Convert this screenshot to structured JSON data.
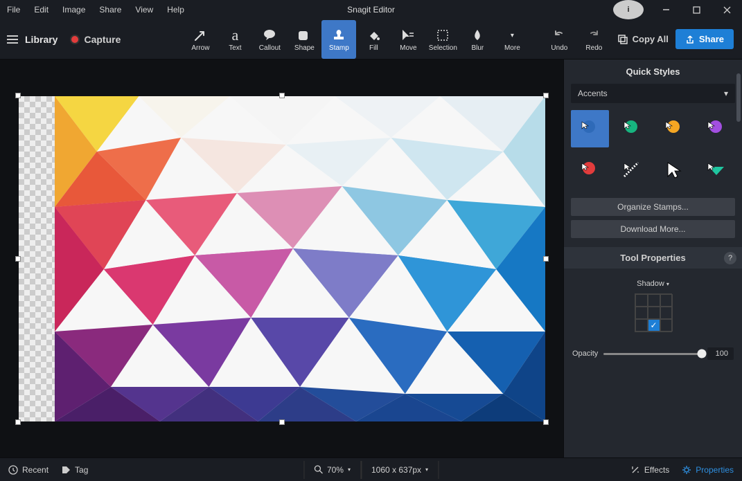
{
  "app_title": "Snagit Editor",
  "menu": [
    "File",
    "Edit",
    "Image",
    "Share",
    "View",
    "Help"
  ],
  "header": {
    "library": "Library",
    "capture": "Capture",
    "copy_all": "Copy All",
    "share": "Share"
  },
  "tools": [
    {
      "id": "arrow",
      "label": "Arrow"
    },
    {
      "id": "text",
      "label": "Text"
    },
    {
      "id": "callout",
      "label": "Callout"
    },
    {
      "id": "shape",
      "label": "Shape"
    },
    {
      "id": "stamp",
      "label": "Stamp",
      "active": true
    },
    {
      "id": "fill",
      "label": "Fill"
    },
    {
      "id": "move",
      "label": "Move"
    },
    {
      "id": "selection",
      "label": "Selection"
    },
    {
      "id": "blur",
      "label": "Blur"
    },
    {
      "id": "more",
      "label": "More"
    },
    {
      "id": "undo",
      "label": "Undo"
    },
    {
      "id": "redo",
      "label": "Redo"
    }
  ],
  "quick_styles": {
    "title": "Quick Styles",
    "category": "Accents",
    "stamp_colors": [
      "#3e78c7",
      "#17b47f",
      "#f5a623",
      "#a24fe0",
      "#e23c3c",
      "#ffffff",
      "#000000",
      "#1fc6a0"
    ],
    "organize": "Organize Stamps...",
    "download": "Download More..."
  },
  "tool_properties": {
    "title": "Tool Properties",
    "shadow_label": "Shadow",
    "opacity_label": "Opacity",
    "opacity_value": "100"
  },
  "status": {
    "recent": "Recent",
    "tag": "Tag",
    "zoom": "70%",
    "dims": "1060 x 637px",
    "effects": "Effects",
    "properties": "Properties"
  }
}
